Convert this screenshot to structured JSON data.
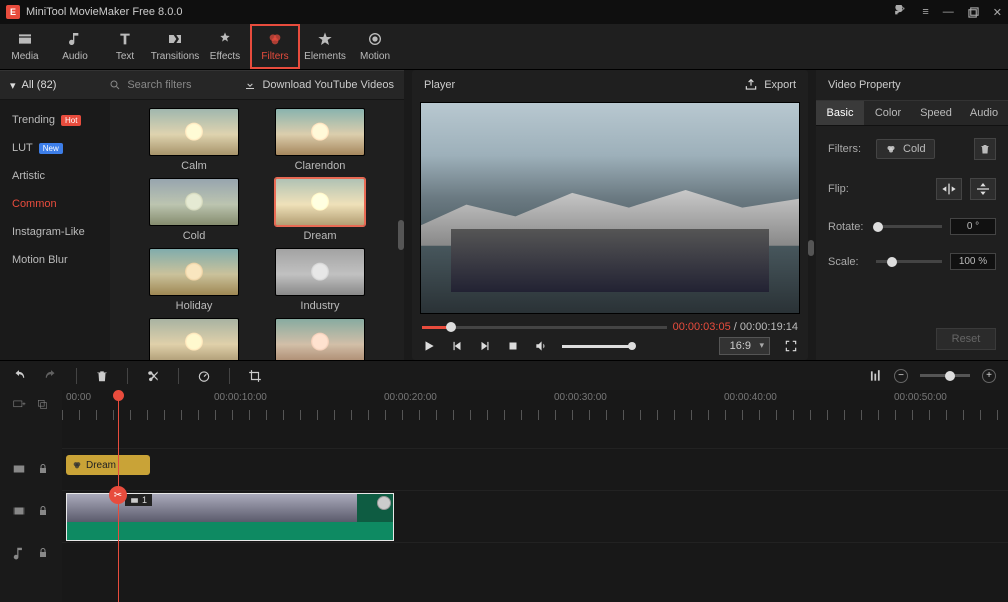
{
  "title": "MiniTool MovieMaker Free 8.0.0",
  "menu": {
    "media": "Media",
    "audio": "Audio",
    "text": "Text",
    "transitions": "Transitions",
    "effects": "Effects",
    "filters": "Filters",
    "elements": "Elements",
    "motion": "Motion"
  },
  "library": {
    "all": "All (82)",
    "search_placeholder": "Search filters",
    "download": "Download YouTube Videos",
    "categories": {
      "trending": "Trending",
      "lut": "LUT",
      "artistic": "Artistic",
      "common": "Common",
      "instagram": "Instagram-Like",
      "motionblur": "Motion Blur"
    },
    "badges": {
      "hot": "Hot",
      "new": "New"
    },
    "thumbs": [
      "Calm",
      "Clarendon",
      "Cold",
      "Dream",
      "Holiday",
      "Industry",
      "",
      ""
    ]
  },
  "player": {
    "title": "Player",
    "export": "Export",
    "current": "00:00:03:05",
    "total": "00:00:19:14",
    "ratio": "16:9"
  },
  "props": {
    "title": "Video Property",
    "tabs": {
      "basic": "Basic",
      "color": "Color",
      "speed": "Speed",
      "audio": "Audio"
    },
    "filters_lbl": "Filters:",
    "filter_name": "Cold",
    "flip_lbl": "Flip:",
    "rotate_lbl": "Rotate:",
    "rotate_val": "0 °",
    "scale_lbl": "Scale:",
    "scale_val": "100 %",
    "reset": "Reset"
  },
  "timeline": {
    "ticks": [
      "00:00",
      "00:00:10:00",
      "00:00:20:00",
      "00:00:30:00",
      "00:00:40:00",
      "00:00:50:00"
    ],
    "filter_clip": "Dream",
    "clip_num1": "1",
    "clip_num2": "1"
  }
}
